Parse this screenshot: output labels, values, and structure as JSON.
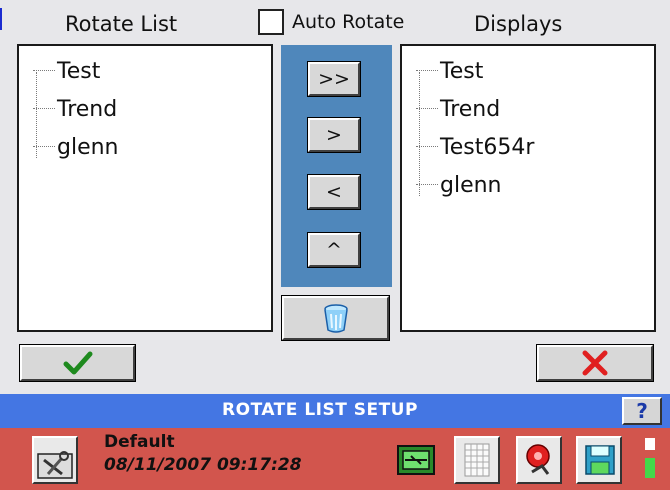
{
  "headers": {
    "rotate_list": "Rotate List",
    "auto_rotate": "Auto Rotate",
    "displays": "Displays"
  },
  "auto_rotate_checked": false,
  "rotate_list": {
    "items": [
      "Test",
      "Trend",
      "glenn"
    ]
  },
  "displays": {
    "items": [
      "Test",
      "Trend",
      "Test654r",
      "glenn"
    ]
  },
  "buttons": {
    "add_all": ">>",
    "add": ">",
    "remove": "<",
    "move_up": "^",
    "delete_icon": "trash-can-icon",
    "confirm_icon": "checkmark-icon",
    "cancel_icon": "x-icon"
  },
  "title_bar": {
    "title": "ROTATE LIST SETUP",
    "help": "?"
  },
  "status_bar": {
    "device_name": "Default",
    "datetime": "08/11/2007 09:17:28",
    "icons": [
      "tools-icon",
      "display-switch-icon",
      "grid-icon",
      "alarm-bell-icon",
      "save-disk-icon"
    ]
  },
  "colors": {
    "background": "#e7e7ea",
    "blue_panel": "#4f87bb",
    "title_bar": "#4476e3",
    "status_bar": "#d2554d",
    "confirm": "#1e8a1e",
    "cancel": "#e02020",
    "status_indicator": "#44d84a"
  }
}
